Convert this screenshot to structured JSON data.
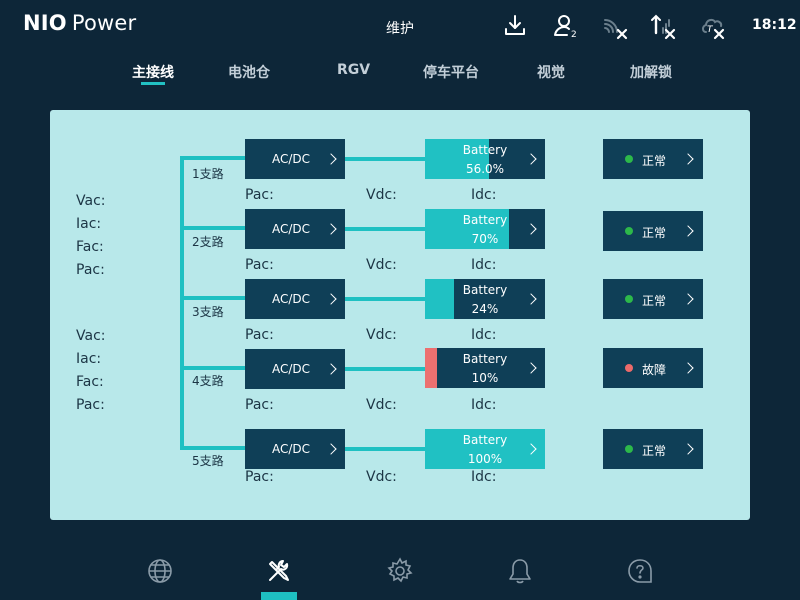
{
  "header": {
    "logo_bold": "NIO",
    "logo_light": "Power",
    "title": "维护",
    "clock": "18:12",
    "icons": [
      "download-icon",
      "user-2-icon",
      "wifi-off-icon",
      "signal-off-icon",
      "cloud-off-icon"
    ]
  },
  "tabs": [
    {
      "label": "主接线",
      "active": true
    },
    {
      "label": "电池仓",
      "active": false
    },
    {
      "label": "RGV",
      "active": false
    },
    {
      "label": "停车平台",
      "active": false
    },
    {
      "label": "视觉",
      "active": false
    },
    {
      "label": "加解锁",
      "active": false
    }
  ],
  "left_labels": {
    "group1": [
      "Vac:",
      "Iac:",
      "Fac:",
      "Pac:"
    ],
    "group2": [
      "Vac:",
      "Iac:",
      "Fac:",
      "Pac:"
    ]
  },
  "branches": [
    {
      "name": "1支路",
      "converter": "AC/DC",
      "battery_label": "Battery",
      "battery_value": "56.0%",
      "battery_fill": 0.53,
      "pac": "Pac:",
      "vdc": "Vdc:",
      "idc": "Idc:",
      "status": "正常",
      "status_color": "#2db84a"
    },
    {
      "name": "2支路",
      "converter": "AC/DC",
      "battery_label": "Battery",
      "battery_value": "70%",
      "battery_fill": 0.7,
      "pac": "Pac:",
      "vdc": "Vdc:",
      "idc": "Idc:",
      "status": "正常",
      "status_color": "#2db84a"
    },
    {
      "name": "3支路",
      "converter": "AC/DC",
      "battery_label": "Battery",
      "battery_value": "24%",
      "battery_fill": 0.24,
      "pac": "Pac:",
      "vdc": "Vdc:",
      "idc": "Idc:",
      "status": "正常",
      "status_color": "#2db84a"
    },
    {
      "name": "4支路",
      "converter": "AC/DC",
      "battery_label": "Battery",
      "battery_value": "10%",
      "battery_fill": 0.1,
      "battery_fill_color": "#ec7070",
      "pac": "Pac:",
      "vdc": "Vdc:",
      "idc": "Idc:",
      "status": "故障",
      "status_color": "#ec6a6a"
    },
    {
      "name": "5支路",
      "converter": "AC/DC",
      "battery_label": "Battery",
      "battery_value": "100%",
      "battery_fill": 1.0,
      "pac": "Pac:",
      "vdc": "Vdc:",
      "idc": "Idc:",
      "status": "正常",
      "status_color": "#2db84a"
    }
  ],
  "colors": {
    "accent": "#1ec0c2",
    "box": "#0f3f57",
    "panel": "#b8e8ea",
    "ok": "#2db84a",
    "fault": "#ec6a6a"
  },
  "bottom_nav": [
    {
      "icon": "globe-icon",
      "active": false
    },
    {
      "icon": "wrench-screwdriver-icon",
      "active": true
    },
    {
      "icon": "gear-icon",
      "active": false
    },
    {
      "icon": "bell-icon",
      "active": false
    },
    {
      "icon": "help-icon",
      "active": false
    }
  ]
}
